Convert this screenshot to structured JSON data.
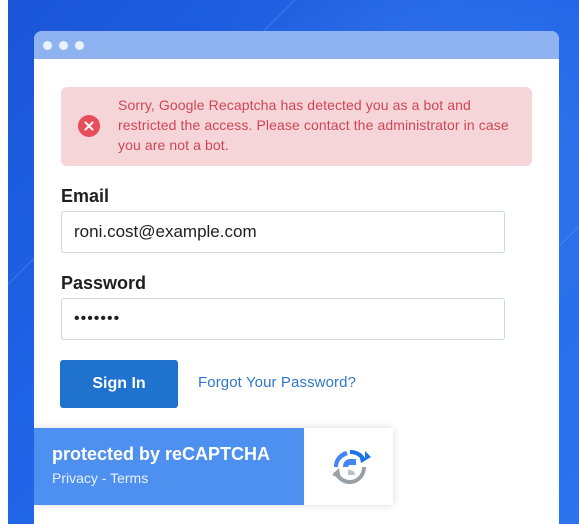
{
  "alert": {
    "message": "Sorry, Google Recaptcha has detected you as a bot and restricted the access. Please contact the administrator in case you are not a bot."
  },
  "form": {
    "email_label": "Email",
    "email_value": "roni.cost@example.com",
    "password_label": "Password",
    "password_value": "•••••••",
    "sign_in_label": "Sign In",
    "forgot_password_label": "Forgot Your Password?"
  },
  "recaptcha": {
    "title": "protected by reCAPTCHA",
    "privacy_label": "Privacy",
    "separator": " - ",
    "terms_label": "Terms"
  },
  "icons": {
    "window_controls": "window-dots-icon",
    "alert": "error-icon",
    "recaptcha": "recaptcha-logo-icon"
  },
  "colors": {
    "background_blue": "#1f63e6",
    "browser_bar": "#8fb3f1",
    "error_background": "#f6d5d8",
    "error_text": "#cf4656",
    "button_blue": "#1f73cf",
    "link_blue": "#2f76cc",
    "recaptcha_blue": "#4d90f0"
  }
}
